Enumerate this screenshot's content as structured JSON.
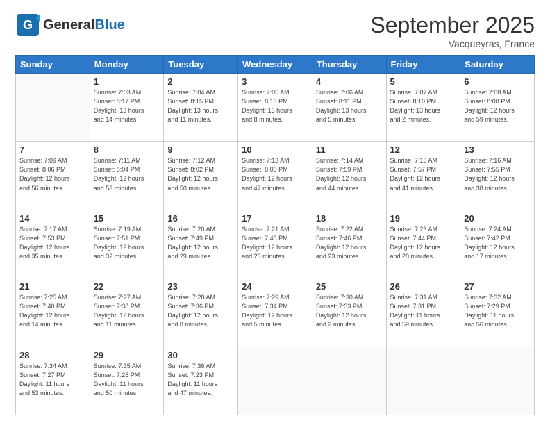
{
  "header": {
    "logo_general": "General",
    "logo_blue": "Blue",
    "title": "September 2025",
    "subtitle": "Vacqueyras, France"
  },
  "days_of_week": [
    "Sunday",
    "Monday",
    "Tuesday",
    "Wednesday",
    "Thursday",
    "Friday",
    "Saturday"
  ],
  "weeks": [
    [
      {
        "day": "",
        "info": ""
      },
      {
        "day": "1",
        "info": "Sunrise: 7:03 AM\nSunset: 8:17 PM\nDaylight: 13 hours\nand 14 minutes."
      },
      {
        "day": "2",
        "info": "Sunrise: 7:04 AM\nSunset: 8:15 PM\nDaylight: 13 hours\nand 11 minutes."
      },
      {
        "day": "3",
        "info": "Sunrise: 7:05 AM\nSunset: 8:13 PM\nDaylight: 13 hours\nand 8 minutes."
      },
      {
        "day": "4",
        "info": "Sunrise: 7:06 AM\nSunset: 8:11 PM\nDaylight: 13 hours\nand 5 minutes."
      },
      {
        "day": "5",
        "info": "Sunrise: 7:07 AM\nSunset: 8:10 PM\nDaylight: 13 hours\nand 2 minutes."
      },
      {
        "day": "6",
        "info": "Sunrise: 7:08 AM\nSunset: 8:08 PM\nDaylight: 12 hours\nand 59 minutes."
      }
    ],
    [
      {
        "day": "7",
        "info": "Sunrise: 7:09 AM\nSunset: 8:06 PM\nDaylight: 12 hours\nand 56 minutes."
      },
      {
        "day": "8",
        "info": "Sunrise: 7:11 AM\nSunset: 8:04 PM\nDaylight: 12 hours\nand 53 minutes."
      },
      {
        "day": "9",
        "info": "Sunrise: 7:12 AM\nSunset: 8:02 PM\nDaylight: 12 hours\nand 50 minutes."
      },
      {
        "day": "10",
        "info": "Sunrise: 7:13 AM\nSunset: 8:00 PM\nDaylight: 12 hours\nand 47 minutes."
      },
      {
        "day": "11",
        "info": "Sunrise: 7:14 AM\nSunset: 7:59 PM\nDaylight: 12 hours\nand 44 minutes."
      },
      {
        "day": "12",
        "info": "Sunrise: 7:15 AM\nSunset: 7:57 PM\nDaylight: 12 hours\nand 41 minutes."
      },
      {
        "day": "13",
        "info": "Sunrise: 7:16 AM\nSunset: 7:55 PM\nDaylight: 12 hours\nand 38 minutes."
      }
    ],
    [
      {
        "day": "14",
        "info": "Sunrise: 7:17 AM\nSunset: 7:53 PM\nDaylight: 12 hours\nand 35 minutes."
      },
      {
        "day": "15",
        "info": "Sunrise: 7:19 AM\nSunset: 7:51 PM\nDaylight: 12 hours\nand 32 minutes."
      },
      {
        "day": "16",
        "info": "Sunrise: 7:20 AM\nSunset: 7:49 PM\nDaylight: 12 hours\nand 29 minutes."
      },
      {
        "day": "17",
        "info": "Sunrise: 7:21 AM\nSunset: 7:48 PM\nDaylight: 12 hours\nand 26 minutes."
      },
      {
        "day": "18",
        "info": "Sunrise: 7:22 AM\nSunset: 7:46 PM\nDaylight: 12 hours\nand 23 minutes."
      },
      {
        "day": "19",
        "info": "Sunrise: 7:23 AM\nSunset: 7:44 PM\nDaylight: 12 hours\nand 20 minutes."
      },
      {
        "day": "20",
        "info": "Sunrise: 7:24 AM\nSunset: 7:42 PM\nDaylight: 12 hours\nand 17 minutes."
      }
    ],
    [
      {
        "day": "21",
        "info": "Sunrise: 7:25 AM\nSunset: 7:40 PM\nDaylight: 12 hours\nand 14 minutes."
      },
      {
        "day": "22",
        "info": "Sunrise: 7:27 AM\nSunset: 7:38 PM\nDaylight: 12 hours\nand 11 minutes."
      },
      {
        "day": "23",
        "info": "Sunrise: 7:28 AM\nSunset: 7:36 PM\nDaylight: 12 hours\nand 8 minutes."
      },
      {
        "day": "24",
        "info": "Sunrise: 7:29 AM\nSunset: 7:34 PM\nDaylight: 12 hours\nand 5 minutes."
      },
      {
        "day": "25",
        "info": "Sunrise: 7:30 AM\nSunset: 7:33 PM\nDaylight: 12 hours\nand 2 minutes."
      },
      {
        "day": "26",
        "info": "Sunrise: 7:31 AM\nSunset: 7:31 PM\nDaylight: 11 hours\nand 59 minutes."
      },
      {
        "day": "27",
        "info": "Sunrise: 7:32 AM\nSunset: 7:29 PM\nDaylight: 11 hours\nand 56 minutes."
      }
    ],
    [
      {
        "day": "28",
        "info": "Sunrise: 7:34 AM\nSunset: 7:27 PM\nDaylight: 11 hours\nand 53 minutes."
      },
      {
        "day": "29",
        "info": "Sunrise: 7:35 AM\nSunset: 7:25 PM\nDaylight: 11 hours\nand 50 minutes."
      },
      {
        "day": "30",
        "info": "Sunrise: 7:36 AM\nSunset: 7:23 PM\nDaylight: 11 hours\nand 47 minutes."
      },
      {
        "day": "",
        "info": ""
      },
      {
        "day": "",
        "info": ""
      },
      {
        "day": "",
        "info": ""
      },
      {
        "day": "",
        "info": ""
      }
    ]
  ]
}
